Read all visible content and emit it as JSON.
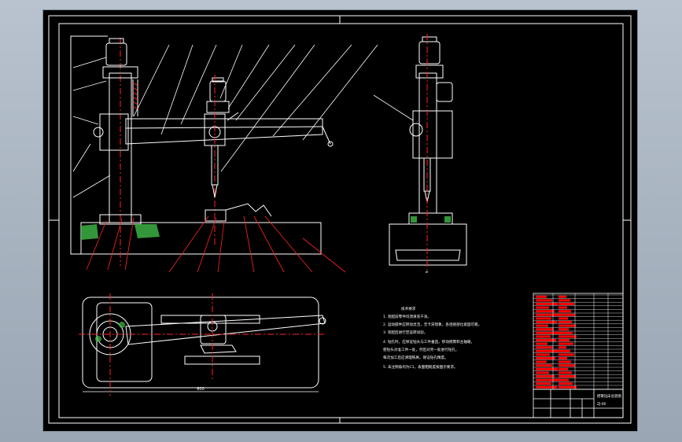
{
  "drawing": {
    "technical_notes": {
      "heading": "技术要求",
      "lines": [
        "1. 装配前零件均须清洗干净。",
        "2. 运动部件应转动灵活，无卡滞现象，各连接部位紧固可靠。",
        "3. 装配后进行空运转试验。",
        "4. 钻孔时，应保证钻头与工件垂直，移动摇臂和主轴箱，",
        "使钻头对准工件一处，然后对另一处进行钻孔，",
        "每次加工后应清理铁屑，保证钻孔精度。",
        "5. 未注倒角均为C1，表面粗糙度按图示要求。"
      ]
    },
    "dimension_front": "⌀",
    "dimension_plan": "800",
    "title_block": {
      "drawing_name": "摇臂钻床总装图",
      "drawing_number": "ZJ-00"
    }
  },
  "colors": {
    "frame": "#ffffff",
    "leader": "#ff2222",
    "hatch": "#3cb043",
    "table_red": "#ff0000",
    "background": "#000000"
  }
}
